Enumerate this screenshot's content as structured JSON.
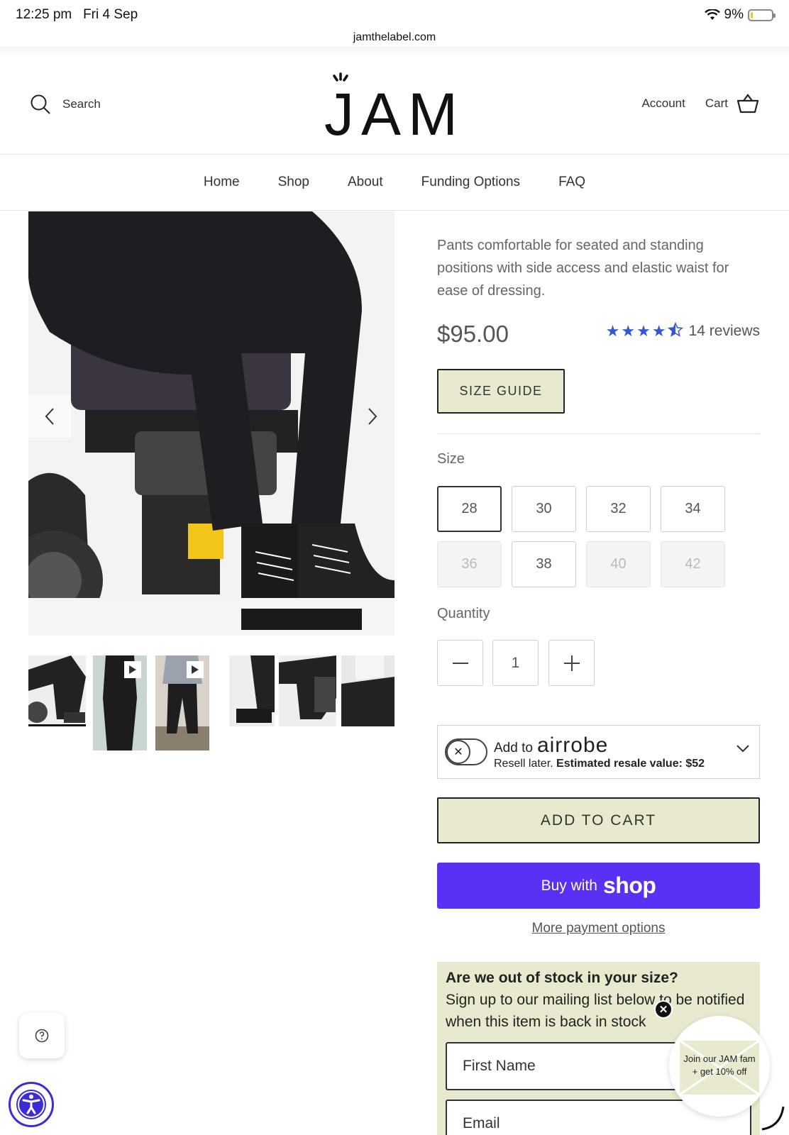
{
  "status_bar": {
    "time": "12:25 pm",
    "date": "Fri 4 Sep",
    "battery": "9%",
    "battery_level": 0.09
  },
  "browser": {
    "url": "jamthelabel.com"
  },
  "header": {
    "search_label": "Search",
    "logo": "JAM",
    "account_label": "Account",
    "cart_label": "Cart"
  },
  "nav": {
    "items": [
      "Home",
      "Shop",
      "About",
      "Funding Options",
      "FAQ"
    ]
  },
  "product": {
    "description": "Pants comfortable for seated and standing positions with side access and elastic waist for ease of dressing.",
    "price": "$95.00",
    "rating": 4.5,
    "reviews_label": "14 reviews",
    "size_guide_label": "SIZE GUIDE",
    "size_label": "Size",
    "sizes": [
      {
        "value": "28",
        "state": "selected"
      },
      {
        "value": "30",
        "state": "available"
      },
      {
        "value": "32",
        "state": "available"
      },
      {
        "value": "34",
        "state": "available"
      },
      {
        "value": "36",
        "state": "disabled"
      },
      {
        "value": "38",
        "state": "available"
      },
      {
        "value": "40",
        "state": "disabled"
      },
      {
        "value": "42",
        "state": "disabled"
      }
    ],
    "quantity_label": "Quantity",
    "quantity": "1"
  },
  "airrobe": {
    "add_to": "Add to",
    "brand": "airrobe",
    "resale_prefix": "Resell later.",
    "resale_value": "Estimated resale value: $52"
  },
  "actions": {
    "add_to_cart": "ADD TO CART",
    "buy_with": "Buy with",
    "shop_brand": "shop",
    "more_payment": "More payment options"
  },
  "out_of_stock": {
    "heading": "Are we out of stock in your size?",
    "text": "Sign up to our mailing list below to be notified when this item is back in stock",
    "first_name_placeholder": "First Name",
    "email_placeholder": "Email"
  },
  "promo": {
    "line1": "Join our JAM fam",
    "line2": "+ get 10% off"
  },
  "colors": {
    "accent_bg": "#e9e9cf",
    "shop_pay": "#5a31f4",
    "stars": "#3355d6",
    "a11y": "#3d2bd6"
  }
}
